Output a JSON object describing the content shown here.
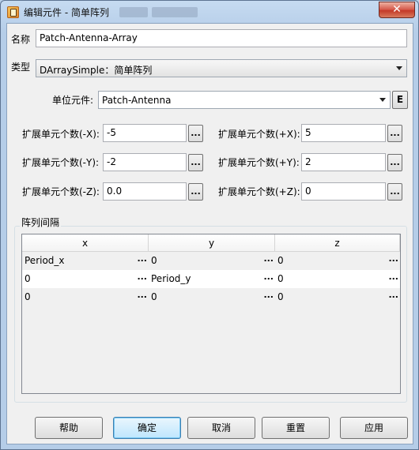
{
  "window": {
    "title": "编辑元件 - 简单阵列",
    "close_label": "✕"
  },
  "name": {
    "label": "名称",
    "value": "Patch-Antenna-Array"
  },
  "type": {
    "label": "类型",
    "value": "DArraySimple：简单阵列"
  },
  "unit": {
    "label": "单位元件:",
    "value": "Patch-Antenna",
    "e_label": "E"
  },
  "expand": {
    "neg_x": {
      "label": "扩展单元个数(-X):",
      "value": "-5"
    },
    "pos_x": {
      "label": "扩展单元个数(+X):",
      "value": "5"
    },
    "neg_y": {
      "label": "扩展单元个数(-Y):",
      "value": "-2"
    },
    "pos_y": {
      "label": "扩展单元个数(+Y):",
      "value": "2"
    },
    "neg_z": {
      "label": "扩展单元个数(-Z):",
      "value": "0.0"
    },
    "pos_z": {
      "label": "扩展单元个数(+Z):",
      "value": "0"
    },
    "dots": "..."
  },
  "spacing": {
    "group_label": "阵列间隔",
    "columns": [
      "x",
      "y",
      "z"
    ],
    "rows": [
      [
        "Period_x",
        "0",
        "0"
      ],
      [
        "0",
        "Period_y",
        "0"
      ],
      [
        "0",
        "0",
        "0"
      ]
    ],
    "dots": "..."
  },
  "buttons": {
    "help": "帮助",
    "ok": "确定",
    "cancel": "取消",
    "reset": "重置",
    "apply": "应用"
  }
}
